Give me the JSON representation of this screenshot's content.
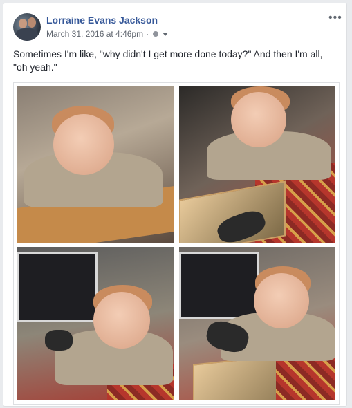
{
  "post": {
    "author": "Lorraine Evans Jackson",
    "date": "March 31, 2016 at 4:46pm",
    "separator": "·",
    "privacy_icon": "globe-icon",
    "menu_icon": "more-options-icon",
    "menu_glyph": "•••",
    "text": "Sometimes I'm like, \"why didn't I get more done today?\" And then I'm all, \"oh yeah.\"",
    "photos": [
      {
        "name": "photo-1",
        "subject": "baby-smiling-at-table"
      },
      {
        "name": "photo-2",
        "subject": "baby-reaching-mouse"
      },
      {
        "name": "photo-3",
        "subject": "baby-holding-mouse-at-monitor"
      },
      {
        "name": "photo-4",
        "subject": "baby-looking-down-at-mouse"
      }
    ]
  },
  "colors": {
    "page_bg": "#e9ebee",
    "card_bg": "#ffffff",
    "author_link": "#365899",
    "meta_text": "#616770",
    "body_text": "#1d2129"
  }
}
